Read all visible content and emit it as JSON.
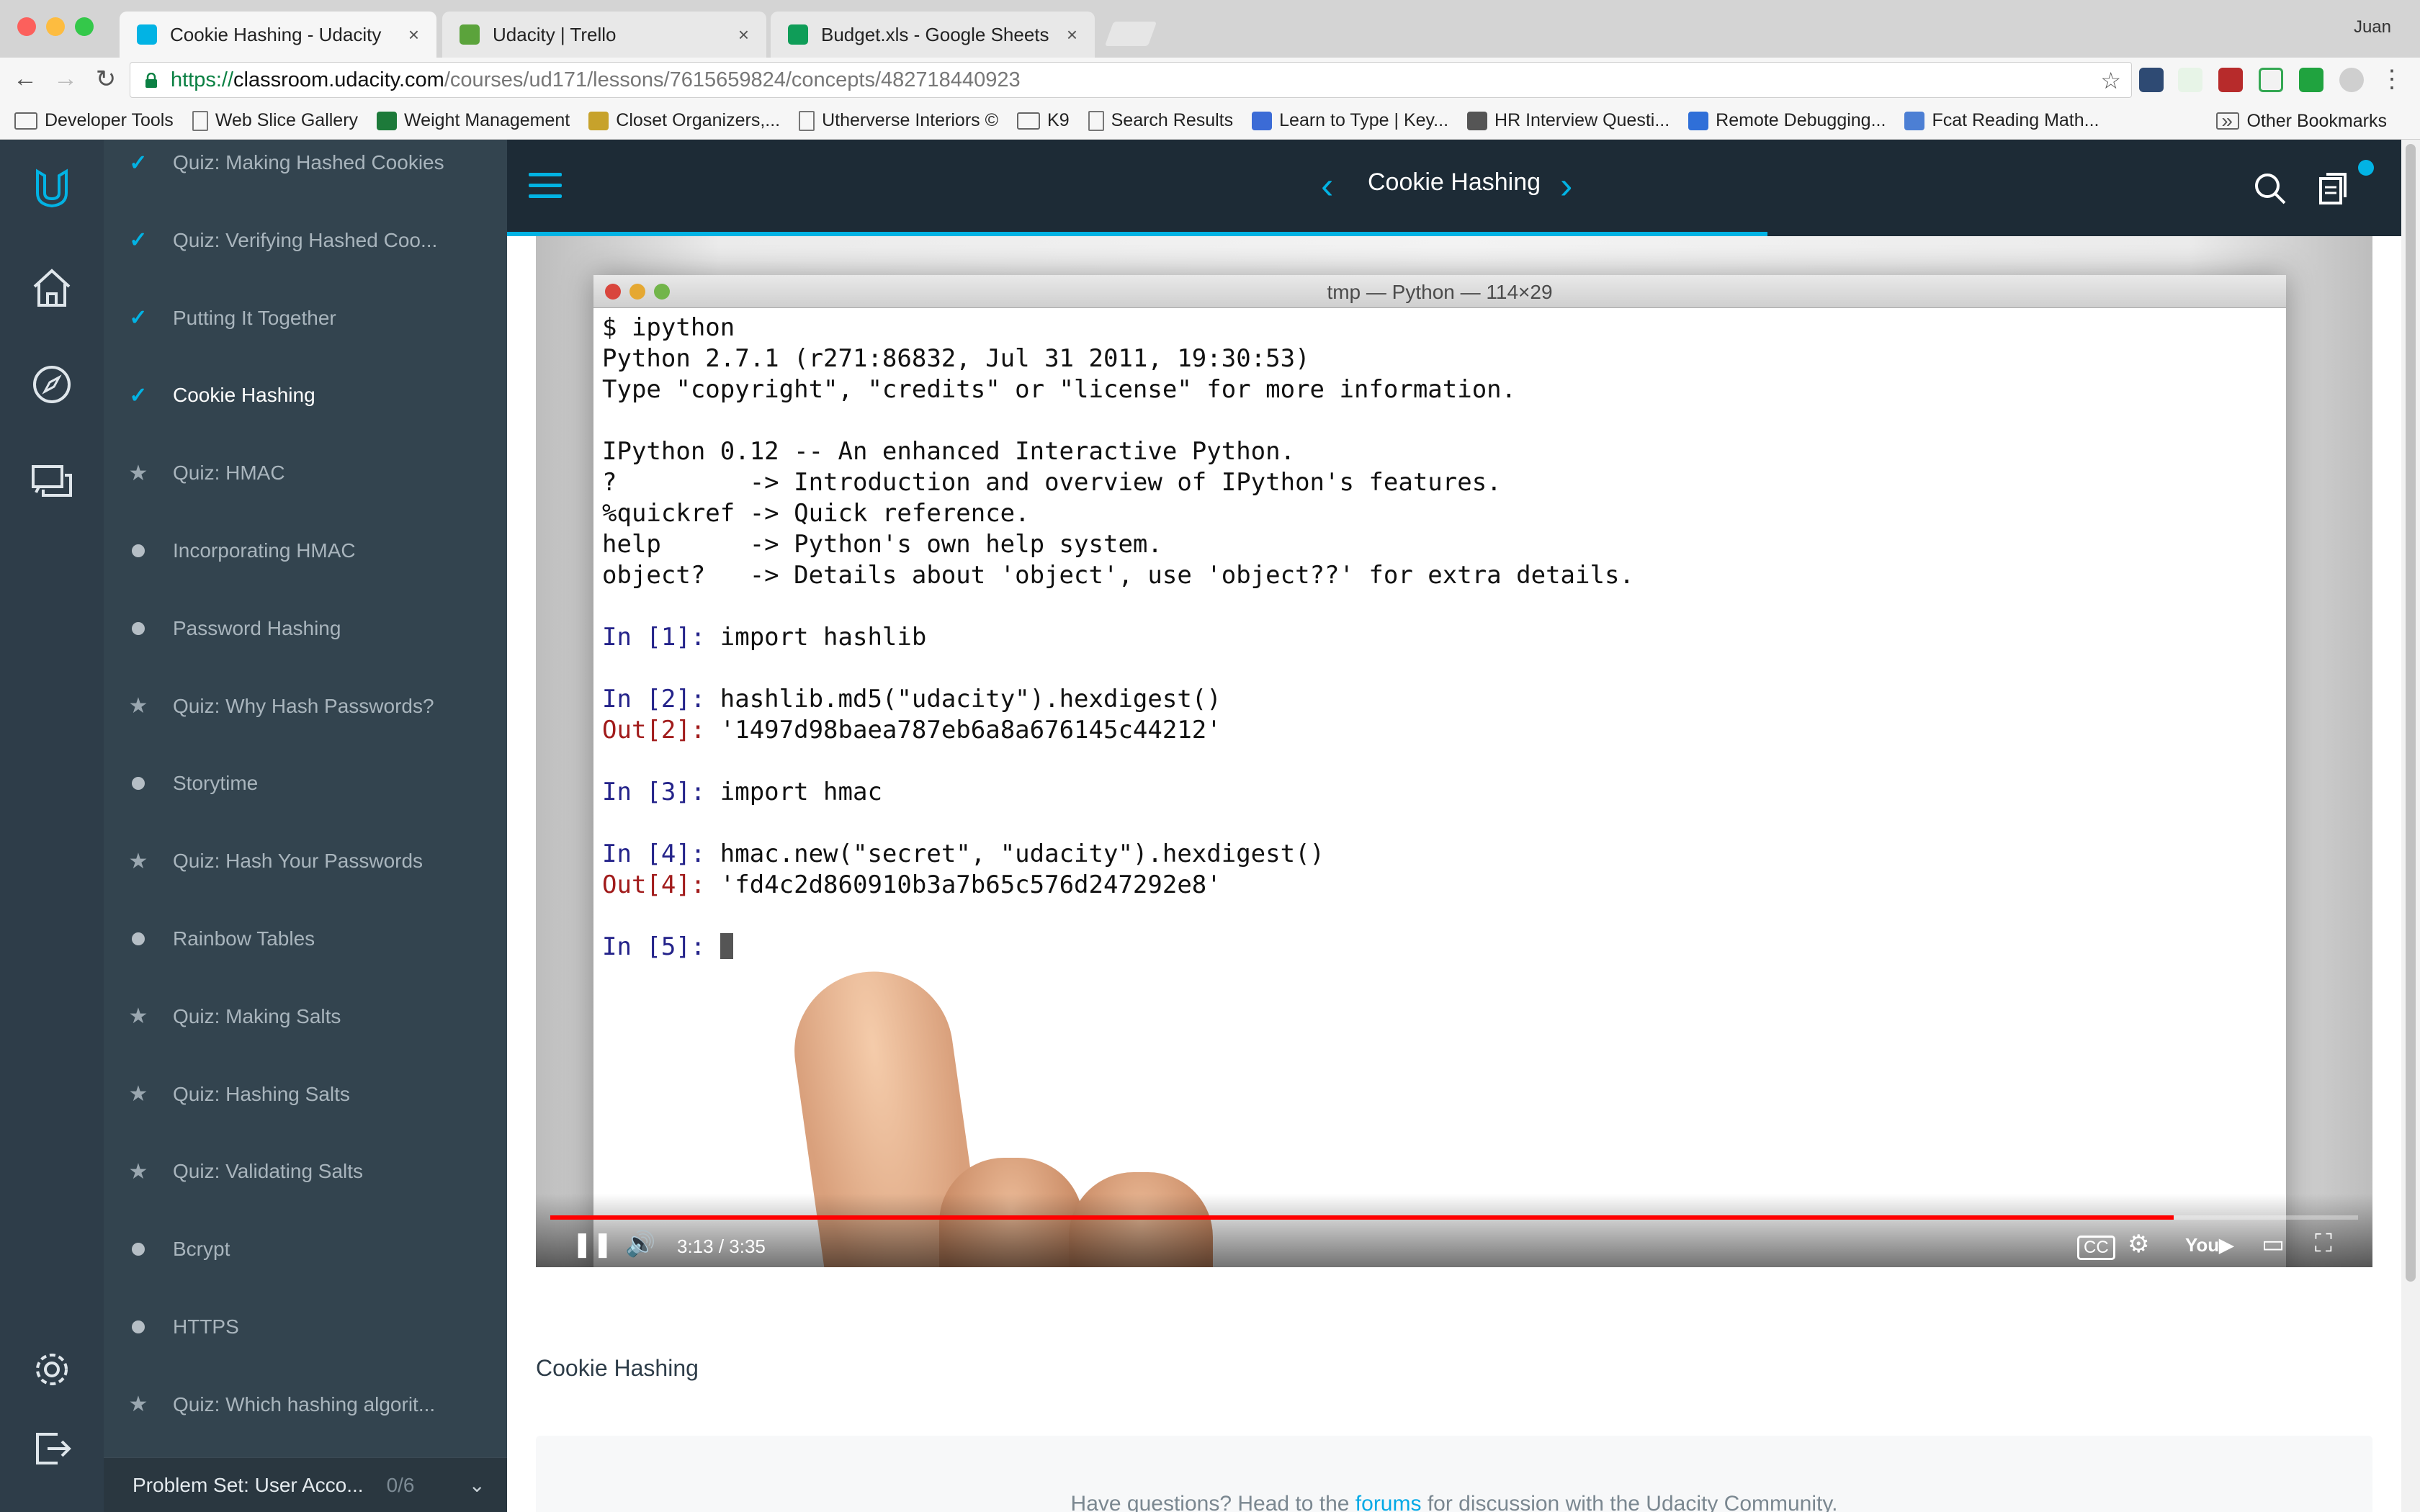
{
  "browser": {
    "user": "Juan",
    "tabs": [
      {
        "title": "Cookie Hashing - Udacity",
        "active": true,
        "color": "#02b3e4"
      },
      {
        "title": "Udacity | Trello",
        "active": false,
        "color": "#5ba33b"
      },
      {
        "title": "Budget.xls - Google Sheets",
        "active": false,
        "color": "#0f9d58"
      }
    ],
    "url": {
      "scheme": "https://",
      "host": "classroom.udacity.com",
      "path": "/courses/ud171/lessons/7615659824/concepts/482718440923"
    },
    "bookmarks": [
      {
        "label": "Developer Tools",
        "type": "folder"
      },
      {
        "label": "Web Slice Gallery",
        "type": "page"
      },
      {
        "label": "Weight Management",
        "type": "site"
      },
      {
        "label": "Closet Organizers,...",
        "type": "site"
      },
      {
        "label": "Utherverse Interiors ©",
        "type": "page"
      },
      {
        "label": "K9",
        "type": "folder"
      },
      {
        "label": "Search Results",
        "type": "page"
      },
      {
        "label": "Learn to Type | Key...",
        "type": "site"
      },
      {
        "label": "HR Interview Questi...",
        "type": "site"
      },
      {
        "label": "Remote Debugging...",
        "type": "site"
      },
      {
        "label": "Fcat Reading Math...",
        "type": "site"
      }
    ],
    "bookmarks_overflow": "»",
    "other_bookmarks": "Other Bookmarks"
  },
  "sidebar": {
    "lessons": [
      {
        "title": "Quiz: Making Hashed Cookies",
        "status": "check"
      },
      {
        "title": "Quiz: Verifying Hashed Coo...",
        "status": "check"
      },
      {
        "title": "Putting It Together",
        "status": "check"
      },
      {
        "title": "Cookie Hashing",
        "status": "check",
        "current": true
      },
      {
        "title": "Quiz: HMAC",
        "status": "star"
      },
      {
        "title": "Incorporating HMAC",
        "status": "dot"
      },
      {
        "title": "Password Hashing",
        "status": "dot"
      },
      {
        "title": "Quiz: Why Hash Passwords?",
        "status": "star"
      },
      {
        "title": "Storytime",
        "status": "dot"
      },
      {
        "title": "Quiz: Hash Your Passwords",
        "status": "star"
      },
      {
        "title": "Rainbow Tables",
        "status": "dot"
      },
      {
        "title": "Quiz: Making Salts",
        "status": "star"
      },
      {
        "title": "Quiz: Hashing Salts",
        "status": "star"
      },
      {
        "title": "Quiz: Validating Salts",
        "status": "star"
      },
      {
        "title": "Bcrypt",
        "status": "dot"
      },
      {
        "title": "HTTPS",
        "status": "dot"
      },
      {
        "title": "Quiz: Which hashing algorit...",
        "status": "star"
      }
    ],
    "problem_set": {
      "title": "Problem Set: User Acco...",
      "count": "0/6"
    }
  },
  "topbar": {
    "concept_title": "Cookie Hashing",
    "accent": "#02b3e4"
  },
  "video": {
    "terminal_title": "tmp — Python — 114×29",
    "lines": [
      {
        "text": "$ ipython"
      },
      {
        "text": "Python 2.7.1 (r271:86832, Jul 31 2011, 19:30:53)"
      },
      {
        "text": "Type \"copyright\", \"credits\" or \"license\" for more information."
      },
      {
        "text": ""
      },
      {
        "text": "IPython 0.12 -- An enhanced Interactive Python."
      },
      {
        "text": "?         -> Introduction and overview of IPython's features."
      },
      {
        "text": "%quickref -> Quick reference."
      },
      {
        "text": "help      -> Python's own help system."
      },
      {
        "text": "object?   -> Details about 'object', use 'object??' for extra details."
      },
      {
        "text": ""
      },
      {
        "prompt": "In [1]:",
        "kind": "in",
        "text": " import hashlib"
      },
      {
        "text": ""
      },
      {
        "prompt": "In [2]:",
        "kind": "in",
        "text": " hashlib.md5(\"udacity\").hexdigest()"
      },
      {
        "prompt": "Out[2]:",
        "kind": "out",
        "text": " '1497d98baea787eb6a8a676145c44212'"
      },
      {
        "text": ""
      },
      {
        "prompt": "In [3]:",
        "kind": "in",
        "text": " import hmac"
      },
      {
        "text": ""
      },
      {
        "prompt": "In [4]:",
        "kind": "in",
        "text": " hmac.new(\"secret\", \"udacity\").hexdigest()"
      },
      {
        "prompt": "Out[4]:",
        "kind": "out",
        "text": " 'fd4c2d860910b3a7b65c576d247292e8'"
      },
      {
        "text": ""
      },
      {
        "prompt": "In [5]:",
        "kind": "in",
        "text": " ",
        "cursor": true
      }
    ],
    "time": "3:13 / 3:35",
    "progress_fraction": 0.898,
    "played_color": "#ff0000"
  },
  "main": {
    "section_title": "Cookie Hashing",
    "forum_prefix": "Have questions? Head to the ",
    "forum_link": "forums",
    "forum_suffix": " for discussion with the Udacity Community."
  }
}
